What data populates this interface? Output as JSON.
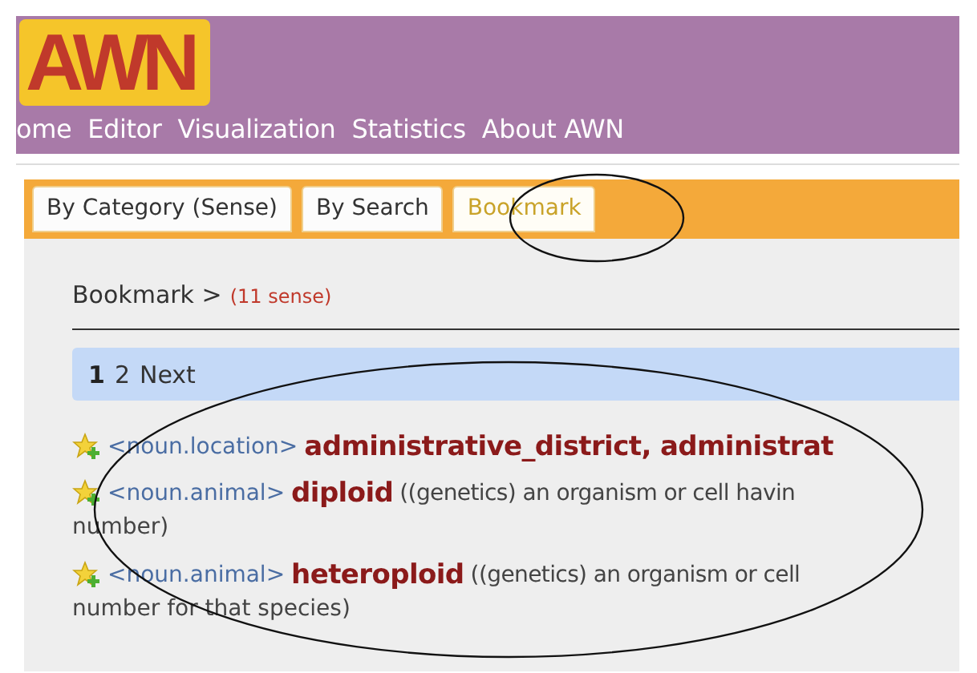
{
  "logo": {
    "text": "AWN"
  },
  "nav": [
    {
      "label": "ome"
    },
    {
      "label": "Editor"
    },
    {
      "label": "Visualization"
    },
    {
      "label": "Statistics"
    },
    {
      "label": "About AWN"
    }
  ],
  "tabs": [
    {
      "label": "By Category (Sense)",
      "selected": false
    },
    {
      "label": "By Search",
      "selected": false
    },
    {
      "label": "Bookmark",
      "selected": true
    }
  ],
  "breadcrumb": {
    "label": "Bookmark >",
    "count": "(11 sense)"
  },
  "pagination": [
    {
      "label": "1",
      "selected": true
    },
    {
      "label": "2",
      "selected": false
    },
    {
      "label": "Next",
      "selected": false
    }
  ],
  "entries": [
    {
      "category": "<noun.location>",
      "word": "administrative_district, administrat"
    },
    {
      "category": "<noun.animal>",
      "word": "diploid",
      "gloss": "((genetics) an organism or cell havin",
      "gloss_continued": "number)"
    },
    {
      "category": "<noun.animal>",
      "word": "heteroploid",
      "gloss": "((genetics) an organism or cell",
      "gloss_continued": "number for that species)"
    }
  ]
}
